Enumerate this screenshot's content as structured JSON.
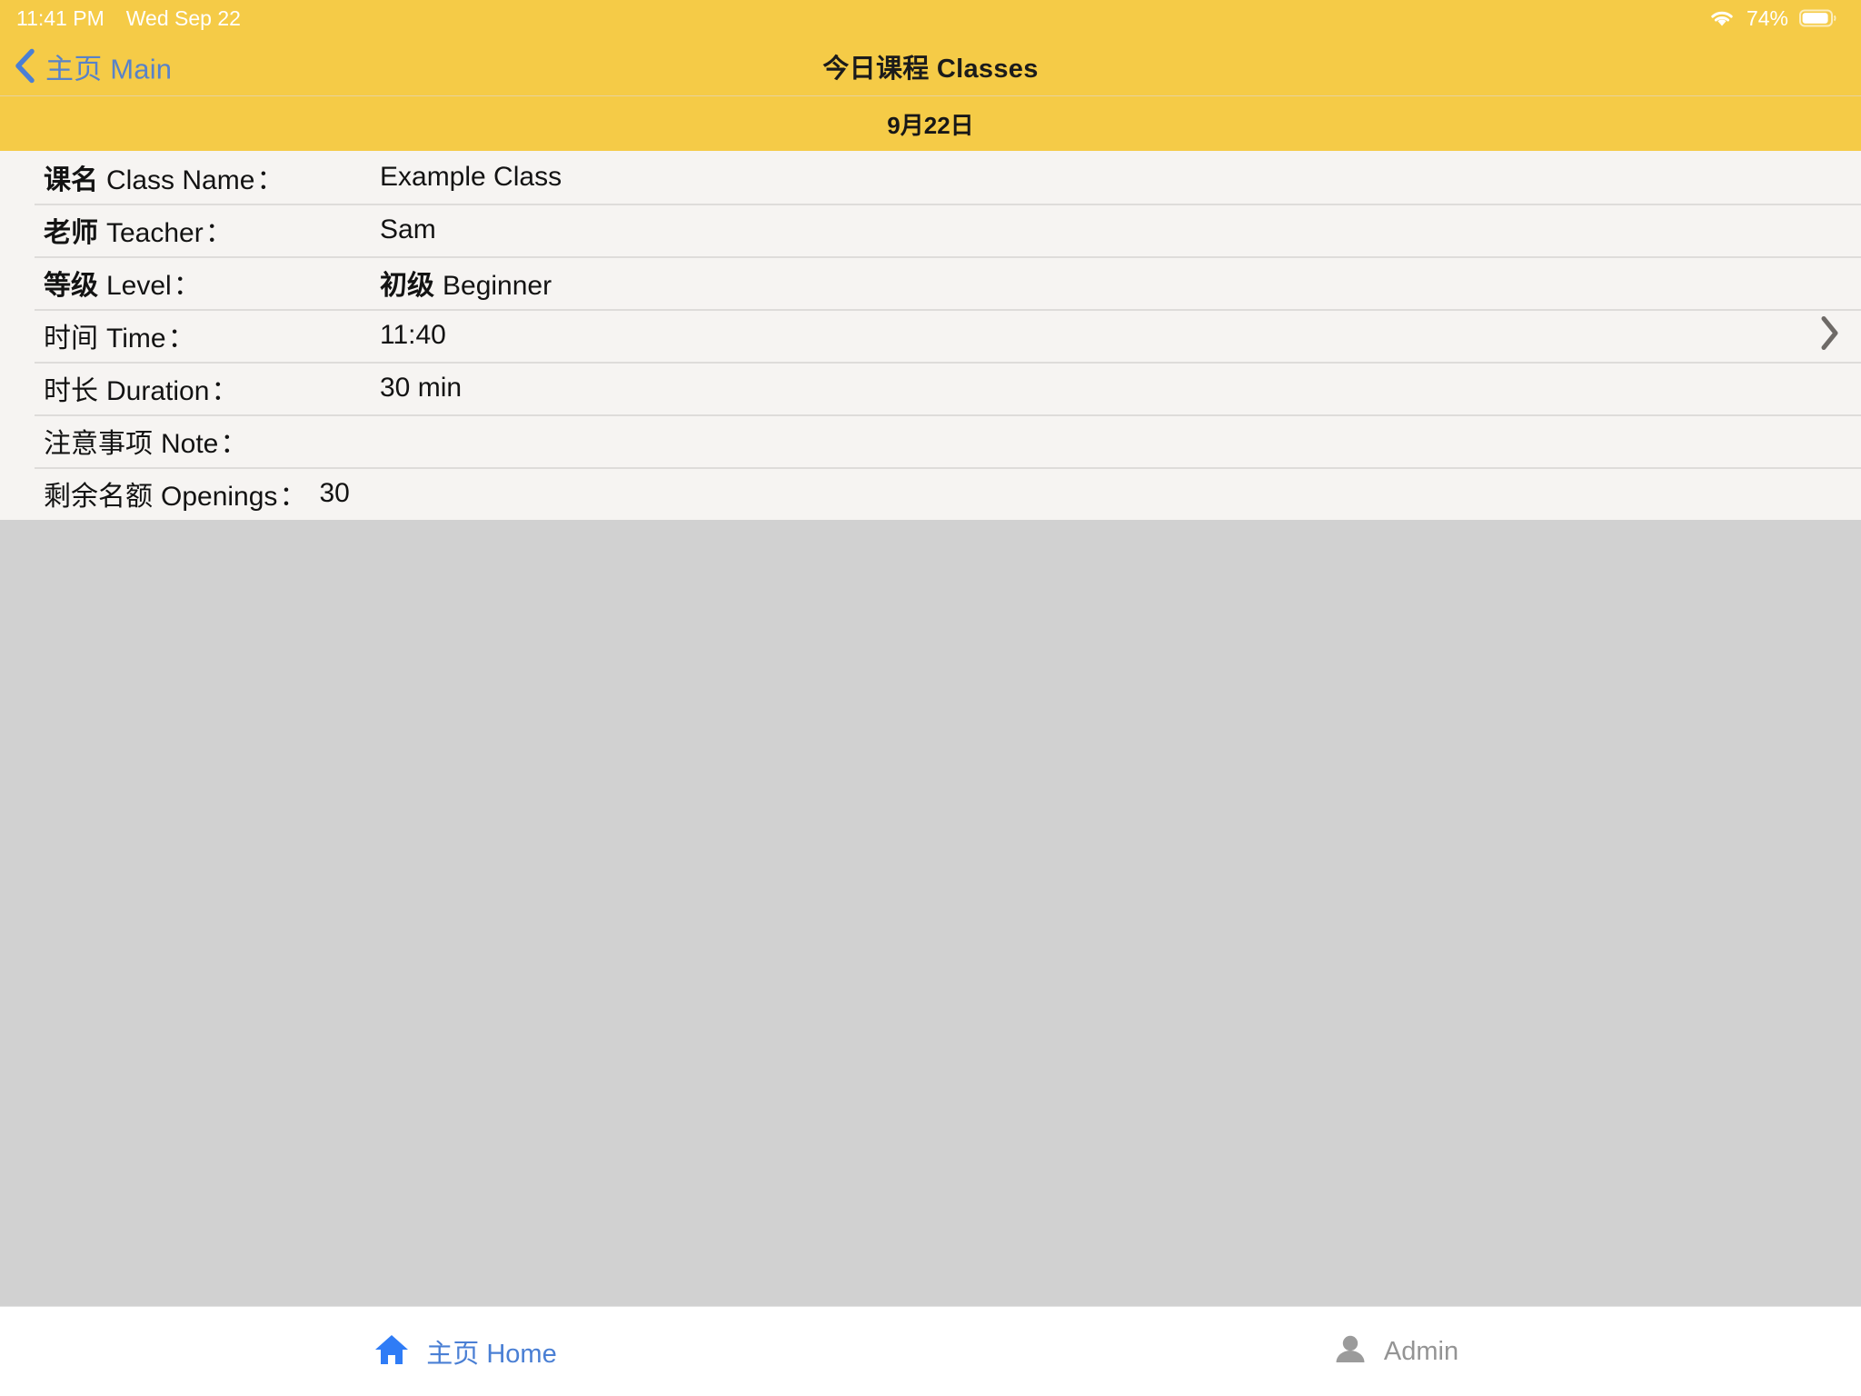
{
  "status_bar": {
    "time": "11:41 PM",
    "date": "Wed Sep 22",
    "battery_percent": "74%",
    "wifi_icon": "wifi-icon",
    "battery_icon": "battery-icon"
  },
  "nav_bar": {
    "back_icon": "chevron-left-icon",
    "back_label_cn": "主页",
    "back_label_en": "Main",
    "title": "今日课程 Classes"
  },
  "date_header": {
    "text": "9月22日"
  },
  "class_detail": {
    "disclosure_icon": "chevron-right-icon",
    "rows": [
      {
        "label_cn": "课名",
        "label_cn_bold": true,
        "label_en": "Class Name",
        "colon": "：",
        "value_cn": "",
        "value_en": "Example Class",
        "value_inline": false
      },
      {
        "label_cn": "老师",
        "label_cn_bold": true,
        "label_en": "Teacher",
        "colon": "：",
        "value_cn": "",
        "value_en": "Sam",
        "value_inline": false
      },
      {
        "label_cn": "等级",
        "label_cn_bold": true,
        "label_en": "Level",
        "colon": "：",
        "value_cn": "初级",
        "value_en": "Beginner",
        "value_inline": false
      },
      {
        "label_cn": "时间",
        "label_cn_bold": false,
        "label_en": "Time",
        "colon": "：",
        "value_cn": "",
        "value_en": "11:40",
        "value_inline": false
      },
      {
        "label_cn": "时长",
        "label_cn_bold": false,
        "label_en": "Duration",
        "colon": "：",
        "value_cn": "",
        "value_en": "30 min",
        "value_inline": false
      },
      {
        "label_cn": "注意事项",
        "label_cn_bold": false,
        "label_en": "Note",
        "colon": "：",
        "value_cn": "",
        "value_en": "",
        "value_inline": false
      },
      {
        "label_cn": "剩余名额",
        "label_cn_bold": false,
        "label_en": "Openings",
        "colon": "：",
        "value_cn": "",
        "value_en": "30",
        "value_inline": true
      }
    ]
  },
  "tab_bar": {
    "tabs": [
      {
        "id": "home",
        "icon": "home-icon",
        "label": "主页 Home",
        "active": true
      },
      {
        "id": "admin",
        "icon": "person-icon",
        "label": "Admin",
        "active": false
      }
    ]
  },
  "colors": {
    "accent_yellow": "#f5cb47",
    "link_blue": "#4a7fd4",
    "table_bg": "#f6f4f2",
    "page_bg": "#d1d1d1",
    "inactive_gray": "#949494"
  }
}
